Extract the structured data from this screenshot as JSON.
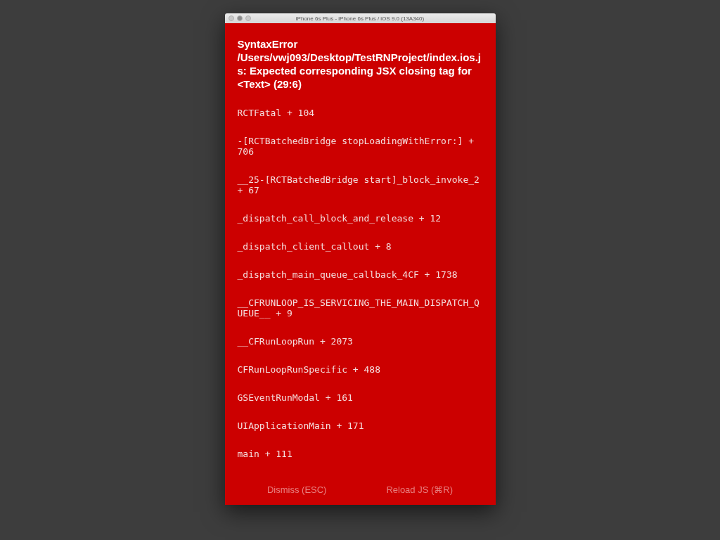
{
  "window": {
    "title": "iPhone 6s Plus - iPhone 6s Plus / iOS 9.0 (13A340)"
  },
  "error": {
    "message": "SyntaxError /Users/vwj093/Desktop/TestRNProject/index.ios.js: Expected corresponding JSX closing tag for <Text> (29:6)"
  },
  "stack_frames": [
    "RCTFatal + 104",
    "-[RCTBatchedBridge stopLoadingWithError:] + 706",
    "__25-[RCTBatchedBridge start]_block_invoke_2 + 67",
    "_dispatch_call_block_and_release + 12",
    "_dispatch_client_callout + 8",
    "_dispatch_main_queue_callback_4CF + 1738",
    "__CFRUNLOOP_IS_SERVICING_THE_MAIN_DISPATCH_QUEUE__ + 9",
    "__CFRunLoopRun + 2073",
    "CFRunLoopRunSpecific + 488",
    "GSEventRunModal + 161",
    "UIApplicationMain + 171",
    "main + 111"
  ],
  "buttons": [
    "Dismiss (ESC)",
    "Reload JS (⌘R)"
  ]
}
